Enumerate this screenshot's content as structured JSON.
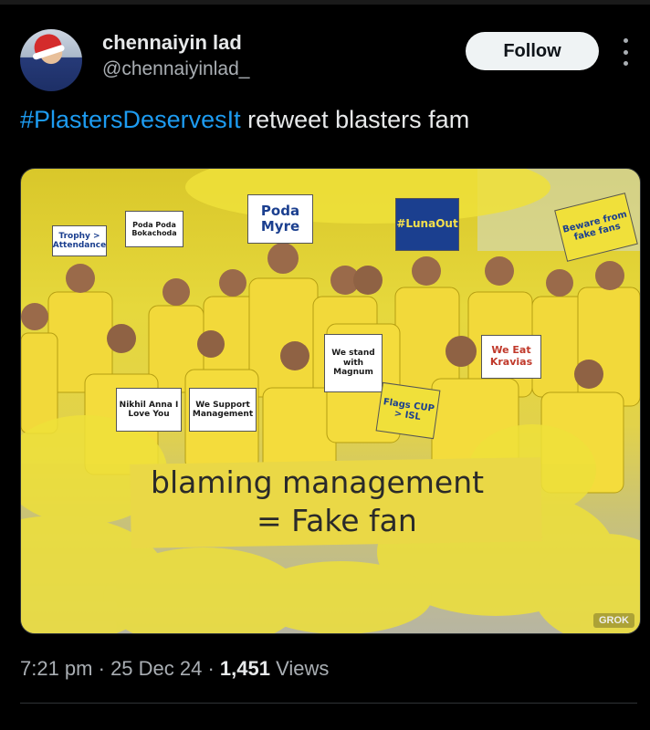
{
  "author": {
    "display_name": "chennaiyin lad",
    "handle": "@chennaiyinlad_",
    "avatar_icon": "avatar-santa-hat"
  },
  "actions": {
    "follow_label": "Follow",
    "more_icon": "more-vertical-icon"
  },
  "tweet": {
    "hashtag": "#PlastersDeservesIt",
    "text": " retweet blasters fam"
  },
  "media": {
    "signs": [
      {
        "id": "s1",
        "text": "Trophy > Attendance"
      },
      {
        "id": "s2",
        "text": "Poda Poda Bokachoda"
      },
      {
        "id": "s3",
        "text": "Poda Myre"
      },
      {
        "id": "s4",
        "text": "#LunaOut"
      },
      {
        "id": "s5",
        "text": "Beware from fake fans"
      },
      {
        "id": "s6",
        "text": "We stand with Magnum"
      },
      {
        "id": "s7",
        "text": "We Eat Kravias"
      },
      {
        "id": "s8",
        "text": "Nikhil Anna I Love You"
      },
      {
        "id": "s9",
        "text": "We Support Management"
      },
      {
        "id": "s10",
        "text": "Flags CUP > ISL"
      }
    ],
    "banner_line1": "blaming management",
    "banner_line2": "= Fake fan",
    "watermark": "GROK"
  },
  "meta": {
    "time": "7:21 pm",
    "sep1": " · ",
    "date": "25 Dec 24",
    "sep2": " · ",
    "views_count": "1,451",
    "views_label": " Views"
  },
  "colors": {
    "background": "#000000",
    "hashtag": "#1d9bf0",
    "text": "#e7e9ea",
    "secondary": "#a9aeb3",
    "jersey_yellow": "#f2d93a"
  }
}
